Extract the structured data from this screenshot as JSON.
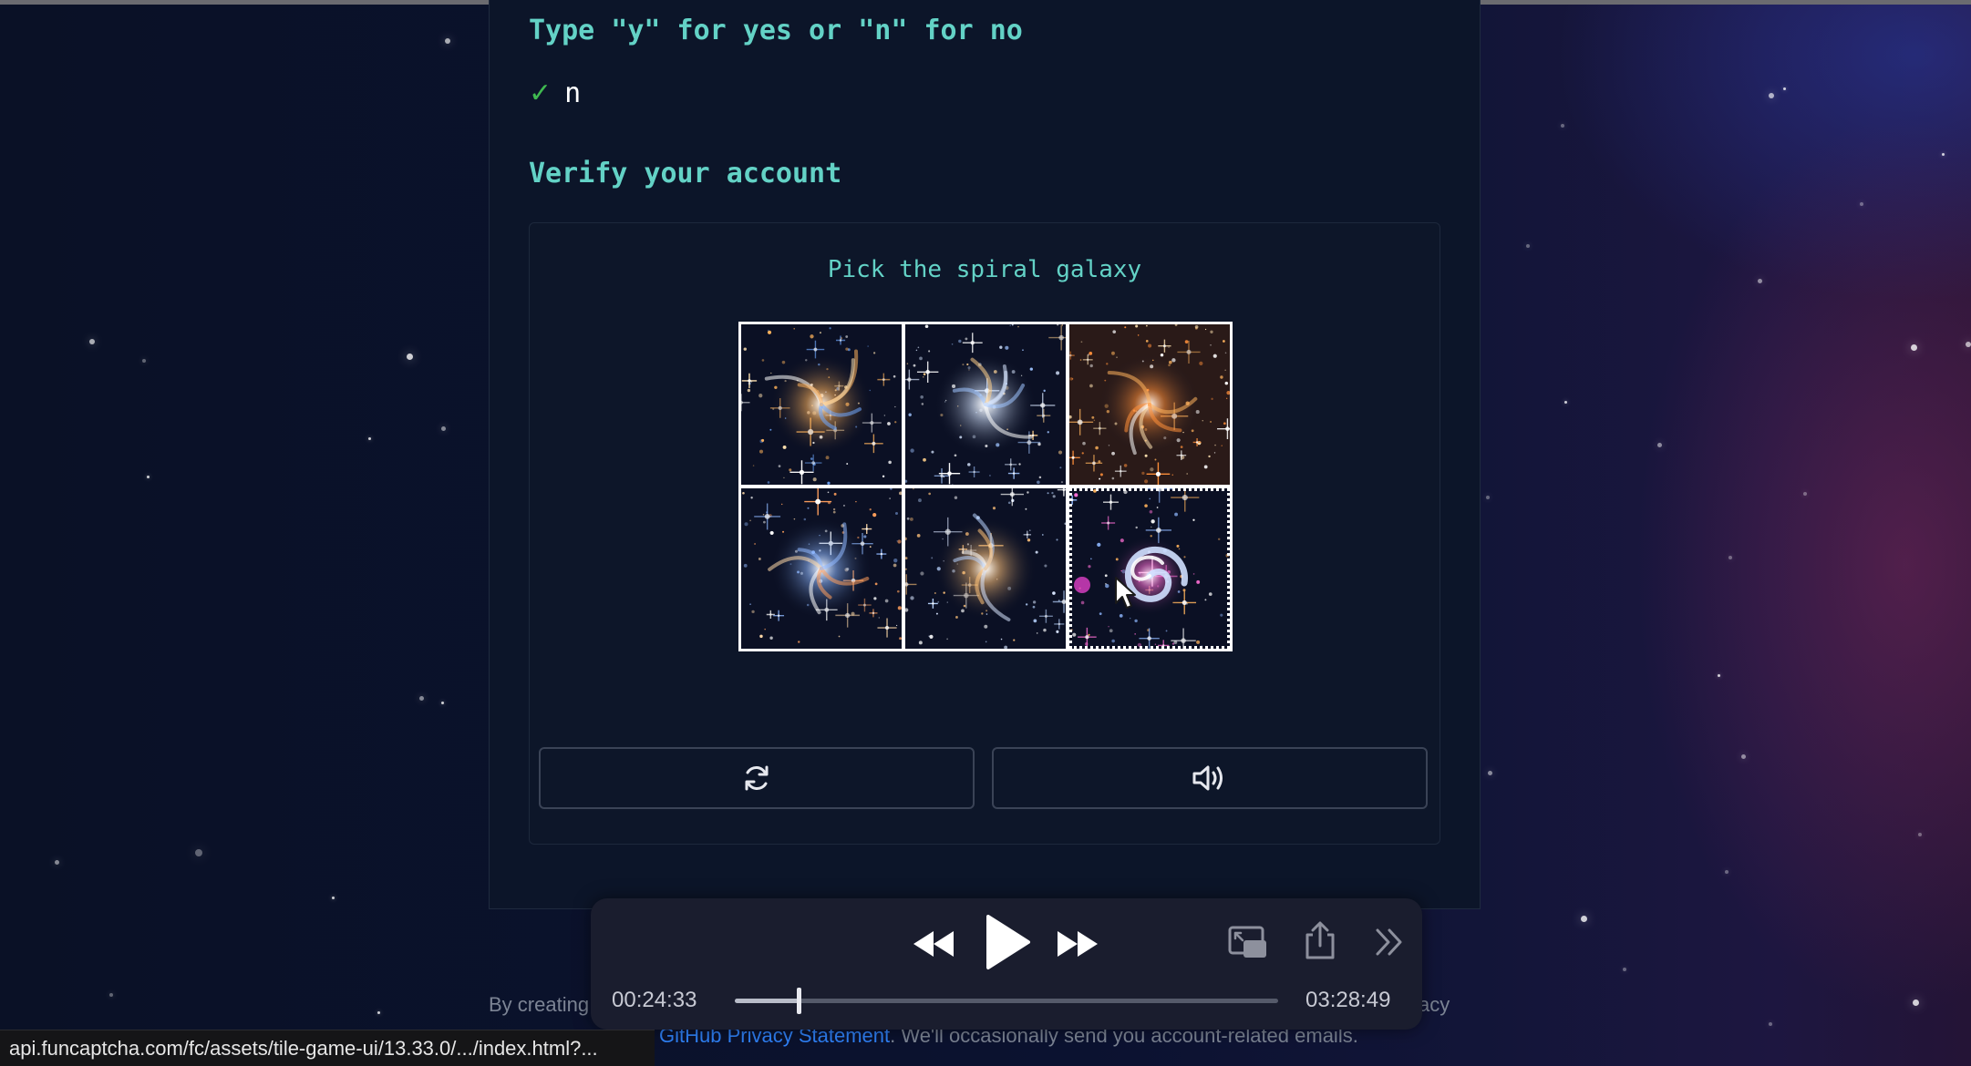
{
  "question": {
    "prompt": "Type \"y\" for yes or \"n\" for no",
    "answer": "n",
    "answered": true
  },
  "verify": {
    "heading": "Verify your account",
    "instruction": "Pick the spiral galaxy",
    "tiles": [
      {
        "image": "galaxy-cluster-1",
        "selected": false
      },
      {
        "image": "galaxy-cluster-2",
        "selected": false
      },
      {
        "image": "galaxy-cluster-3",
        "selected": false
      },
      {
        "image": "galaxy-cluster-4",
        "selected": false
      },
      {
        "image": "galaxy-cluster-5",
        "selected": false
      },
      {
        "image": "spiral-galaxy",
        "selected": true
      }
    ],
    "reload_icon": "refresh-icon",
    "audio_icon": "speaker-icon"
  },
  "player": {
    "elapsed": "00:24:33",
    "total": "03:28:49",
    "progress": 0.1176,
    "icons": [
      "rewind-icon",
      "play-icon",
      "fast-forward-icon",
      "picture-in-picture-icon",
      "share-icon",
      "playback-speed-icon"
    ]
  },
  "footer": {
    "left_text": "By creating",
    "right_text": "acy",
    "link_text": "GitHub Privacy Statement",
    "line_text": ". We'll occasionally send you account-related emails."
  },
  "statusbar": {
    "url": "api.funcaptcha.com/fc/assets/tile-game-ui/13.33.0/.../index.html?..."
  },
  "colors": {
    "accent": "#63d2c6",
    "check": "#3fb950",
    "link": "#2f81f7"
  }
}
